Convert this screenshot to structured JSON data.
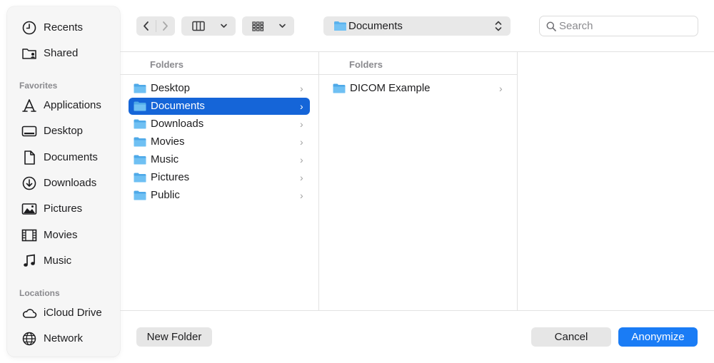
{
  "sidebar": {
    "items_top": [
      {
        "label": "Recents",
        "icon": "clock-icon"
      },
      {
        "label": "Shared",
        "icon": "shared-folder-icon"
      }
    ],
    "favorites_heading": "Favorites",
    "favorites": [
      {
        "label": "Applications",
        "icon": "applications-icon"
      },
      {
        "label": "Desktop",
        "icon": "desktop-icon"
      },
      {
        "label": "Documents",
        "icon": "document-icon"
      },
      {
        "label": "Downloads",
        "icon": "download-icon"
      },
      {
        "label": "Pictures",
        "icon": "pictures-icon"
      },
      {
        "label": "Movies",
        "icon": "film-icon"
      },
      {
        "label": "Music",
        "icon": "music-note-icon"
      }
    ],
    "locations_heading": "Locations",
    "locations": [
      {
        "label": "iCloud Drive",
        "icon": "cloud-icon"
      },
      {
        "label": "Network",
        "icon": "globe-icon"
      }
    ]
  },
  "toolbar": {
    "path_label": "Documents",
    "search_placeholder": "Search"
  },
  "columns": [
    {
      "heading": "Folders",
      "rows": [
        "Desktop",
        "Documents",
        "Downloads",
        "Movies",
        "Music",
        "Pictures",
        "Public"
      ],
      "selected": "Documents"
    },
    {
      "heading": "Folders",
      "rows": [
        "DICOM Example"
      ]
    }
  ],
  "footer": {
    "new_folder": "New Folder",
    "cancel": "Cancel",
    "confirm": "Anonymize"
  },
  "colors": {
    "accent": "#1a7cf5",
    "selection": "#1565d8",
    "folder": "#5ab3ee"
  }
}
